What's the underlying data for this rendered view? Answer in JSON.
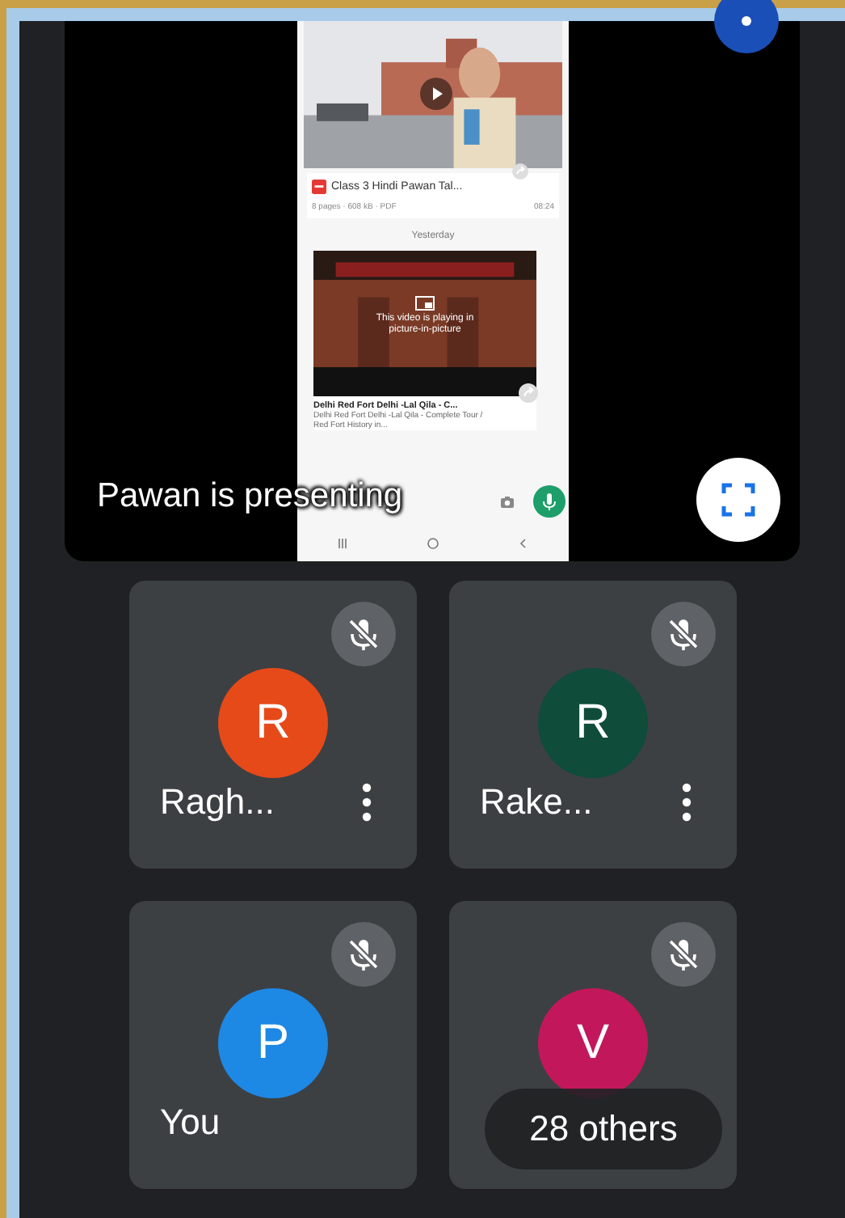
{
  "presentation": {
    "presenter_label": "Pawan is presenting",
    "shared_screen": {
      "file": {
        "title": "Class 3 Hindi Pawan Tal...",
        "meta": "8 pages · 608 kB · PDF",
        "time": "08:24"
      },
      "divider": "Yesterday",
      "video": {
        "overlay": "This video is playing in picture-in-picture",
        "title": "Delhi Red Fort Delhi -Lal Qila - C...",
        "description": "Delhi Red Fort Delhi -Lal Qila - Complete Tour / Red Fort History in..."
      }
    }
  },
  "participants": [
    {
      "initial": "R",
      "name": "Ragh...",
      "color": "#e64a19",
      "muted": true,
      "has_menu": true
    },
    {
      "initial": "R",
      "name": "Rake...",
      "color": "#0f4c3a",
      "muted": true,
      "has_menu": true
    },
    {
      "initial": "P",
      "name": "You",
      "color": "#1e88e5",
      "muted": true,
      "has_menu": false
    },
    {
      "initial": "V",
      "color": "#c2185b",
      "muted": true,
      "has_menu": false
    }
  ],
  "overflow": {
    "label": "28 others"
  }
}
